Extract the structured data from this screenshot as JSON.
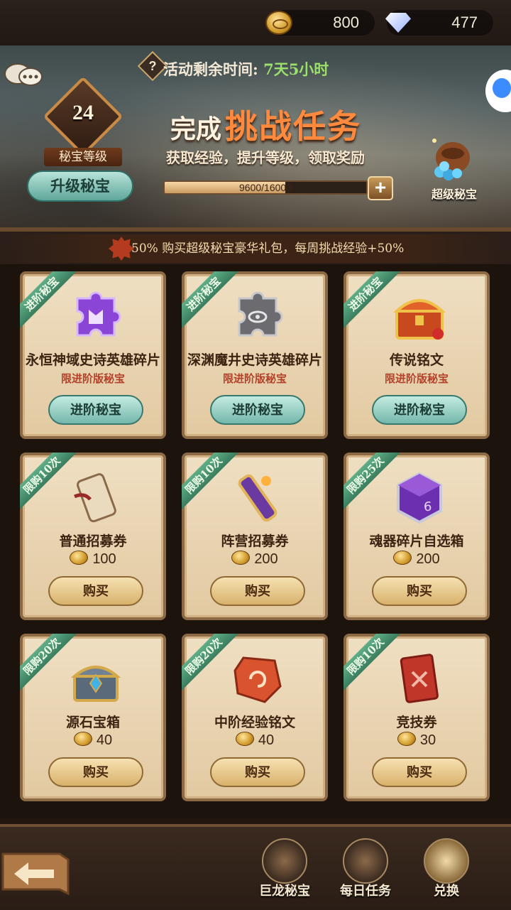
{
  "currency": {
    "gold": "800",
    "gems": "477"
  },
  "banner": {
    "timer_label": "活动剩余时间:",
    "timer_value": "7天5小时",
    "level": "24",
    "level_label": "秘宝等级",
    "upgrade_button": "升级秘宝",
    "headline_a": "完成",
    "headline_b": "挑战任务",
    "subline": "获取经验，提升等级，领取奖励",
    "progress_text": "9600/16000",
    "progress_fraction": 0.6,
    "plus_label": "+",
    "super_label": "超级秘宝"
  },
  "promo": {
    "badge": "+50%",
    "text": "购买超级秘宝豪华礼包，每周挑战经验+50%"
  },
  "cards": [
    {
      "ribbon": "进阶秘宝",
      "name": "永恒神域史诗英雄碎片",
      "sub": "限进阶版秘宝",
      "button": "进阶秘宝",
      "icon": "purple-puzzle-icon"
    },
    {
      "ribbon": "进阶秘宝",
      "name": "深渊魔井史诗英雄碎片",
      "sub": "限进阶版秘宝",
      "button": "进阶秘宝",
      "icon": "grey-puzzle-icon"
    },
    {
      "ribbon": "进阶秘宝",
      "name": "传说铭文",
      "sub": "限进阶版秘宝",
      "button": "进阶秘宝",
      "icon": "gold-chest-icon"
    },
    {
      "ribbon": "限购10次",
      "name": "普通招募券",
      "price": "100",
      "button": "购买",
      "icon": "scroll-icon"
    },
    {
      "ribbon": "限购10次",
      "name": "阵营招募券",
      "price": "200",
      "button": "购买",
      "icon": "faction-scroll-icon"
    },
    {
      "ribbon": "限购25次",
      "name": "魂器碎片自选箱",
      "price": "200",
      "button": "购买",
      "icon": "soul-box-icon"
    },
    {
      "ribbon": "限购20次",
      "name": "源石宝箱",
      "price": "40",
      "button": "购买",
      "icon": "source-chest-icon"
    },
    {
      "ribbon": "限购20次",
      "name": "中阶经验铭文",
      "price": "40",
      "button": "购买",
      "icon": "red-rune-icon"
    },
    {
      "ribbon": "限购10次",
      "name": "竞技券",
      "price": "30",
      "button": "购买",
      "icon": "arena-ticket-icon"
    }
  ],
  "nav": {
    "item1": "巨龙秘宝",
    "item2": "每日任务",
    "item3": "兑换"
  }
}
